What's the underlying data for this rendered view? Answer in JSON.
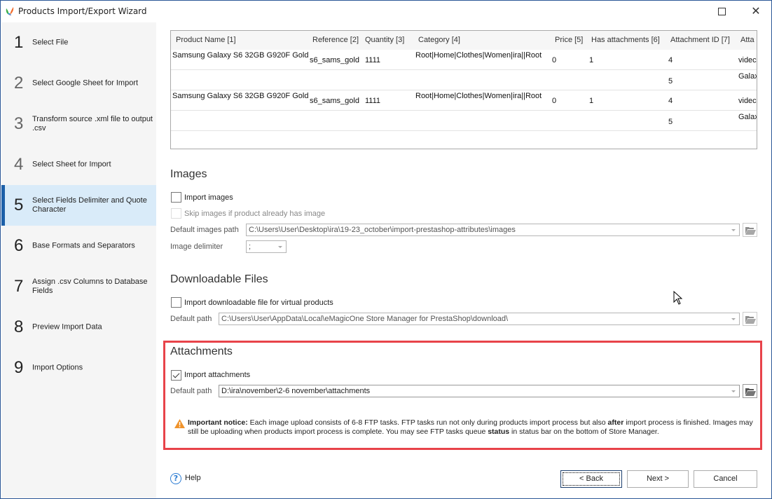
{
  "window": {
    "title": "Products Import/Export Wizard",
    "controls": [
      "maximize-icon",
      "close-icon"
    ]
  },
  "sidebar": {
    "steps": [
      {
        "num": "1",
        "label": "Select File"
      },
      {
        "num": "2",
        "label": "Select Google Sheet for Import"
      },
      {
        "num": "3",
        "label": "Transform source .xml file to output .csv"
      },
      {
        "num": "4",
        "label": "Select Sheet for Import"
      },
      {
        "num": "5",
        "label": "Select Fields Delimiter and Quote Character"
      },
      {
        "num": "6",
        "label": "Base Formats and Separators"
      },
      {
        "num": "7",
        "label": "Assign .csv Columns to Database Fields"
      },
      {
        "num": "8",
        "label": "Preview Import Data"
      },
      {
        "num": "9",
        "label": "Import Options"
      }
    ],
    "active_step": 5
  },
  "preview_grid": {
    "columns": [
      "Product Name [1]",
      "Reference [2]",
      "Quantity [3]",
      "Category [4]",
      "Price [5]",
      "Has attachments [6]",
      "Attachment ID [7]",
      "Atta"
    ],
    "rows": [
      [
        "Samsung Galaxy S6 32GB G920F Gold",
        "s6_sams_gold",
        "1111",
        "Root|Home|Clothes|Women|ira||Root",
        "0",
        "1",
        "4",
        "videc"
      ],
      [
        "",
        "",
        "",
        "",
        "",
        "",
        "5",
        "Galax"
      ],
      [
        "Samsung Galaxy S6 32GB G920F Gold",
        "s6_sams_gold",
        "1111",
        "Root|Home|Clothes|Women|ira||Root",
        "0",
        "1",
        "4",
        "videc"
      ],
      [
        "",
        "",
        "",
        "",
        "",
        "",
        "5",
        "Galax"
      ]
    ]
  },
  "images": {
    "title": "Images",
    "import_images_label": "Import images",
    "import_images_checked": false,
    "skip_images_label": "Skip images if product already has image",
    "skip_images_checked": false,
    "default_path_label": "Default images path",
    "default_path_value": "C:\\Users\\User\\Desktop\\ira\\19-23_october\\import-prestashop-attributes\\images",
    "delimiter_label": "Image delimiter",
    "delimiter_value": ";"
  },
  "downloadable": {
    "title": "Downloadable Files",
    "import_label": "Import downloadable file for virtual products",
    "import_checked": false,
    "default_path_label": "Default path",
    "default_path_value": "C:\\Users\\User\\AppData\\Local\\eMagicOne Store Manager for PrestaShop\\download\\"
  },
  "attachments": {
    "title": "Attachments",
    "import_label": "Import attachments",
    "import_checked": true,
    "default_path_label": "Default path",
    "default_path_value": "D:\\ira\\november\\2-6 november\\attachments"
  },
  "notice": {
    "bold_lead": "Important notice:",
    "part1": " Each image upload consists of 6-8 FTP tasks. FTP tasks run not only during products import process but also ",
    "bold_after": "after",
    "part2": " import process is finished. Images may still be uploading when products import process is complete. You may see FTP tasks queue ",
    "bold_status": "status",
    "part3": " in status bar on the bottom of Store Manager."
  },
  "footer": {
    "help_label": "Help",
    "back_label": "< Back",
    "next_label": "Next >",
    "cancel_label": "Cancel"
  },
  "colors": {
    "active_step_bg": "#d9ebf9",
    "active_step_bar": "#1c5fa8",
    "highlight_border": "#e8434a",
    "warning": "#f0932b",
    "help_accent": "#2b7cd3"
  }
}
